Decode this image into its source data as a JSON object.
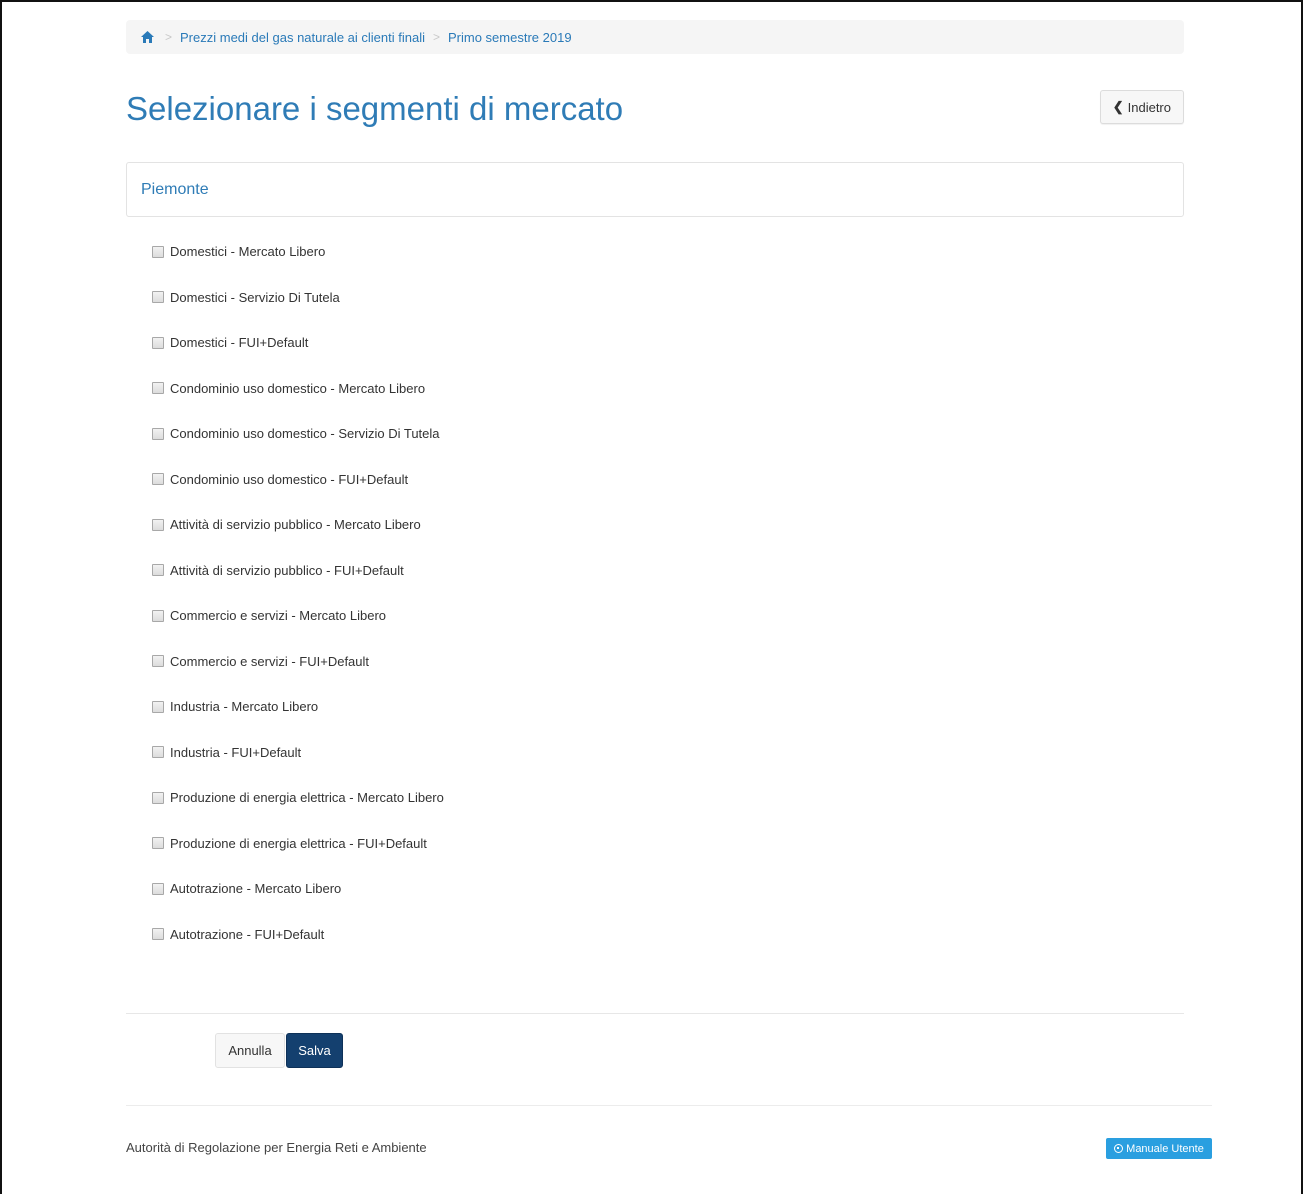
{
  "breadcrumb": {
    "items": [
      {
        "label": "Prezzi medi del gas naturale ai clienti finali"
      },
      {
        "label": "Primo semestre 2019"
      }
    ],
    "separator": ">"
  },
  "header": {
    "title": "Selezionare i segmenti di mercato",
    "back_label": "Indietro"
  },
  "panel": {
    "title": "Piemonte"
  },
  "segments": [
    {
      "label": "Domestici - Mercato Libero",
      "checked": false
    },
    {
      "label": "Domestici - Servizio Di Tutela",
      "checked": false
    },
    {
      "label": "Domestici - FUI+Default",
      "checked": false
    },
    {
      "label": "Condominio uso domestico - Mercato Libero",
      "checked": false
    },
    {
      "label": "Condominio uso domestico - Servizio Di Tutela",
      "checked": false
    },
    {
      "label": "Condominio uso domestico - FUI+Default",
      "checked": false
    },
    {
      "label": "Attività di servizio pubblico - Mercato Libero",
      "checked": false
    },
    {
      "label": "Attività di servizio pubblico - FUI+Default",
      "checked": false
    },
    {
      "label": "Commercio e servizi - Mercato Libero",
      "checked": false
    },
    {
      "label": "Commercio e servizi - FUI+Default",
      "checked": false
    },
    {
      "label": "Industria - Mercato Libero",
      "checked": false
    },
    {
      "label": "Industria - FUI+Default",
      "checked": false
    },
    {
      "label": "Produzione di energia elettrica - Mercato Libero",
      "checked": false
    },
    {
      "label": "Produzione di energia elettrica - FUI+Default",
      "checked": false
    },
    {
      "label": "Autotrazione - Mercato Libero",
      "checked": false
    },
    {
      "label": "Autotrazione - FUI+Default",
      "checked": false
    }
  ],
  "actions": {
    "cancel_label": "Annulla",
    "save_label": "Salva"
  },
  "footer": {
    "org": "Autorità di Regolazione per Energia Reti e Ambiente",
    "manual_label": "Manuale Utente"
  },
  "colors": {
    "accent": "#2f7cb6",
    "save_button": "#14406f",
    "manual_button": "#2a9fe0"
  }
}
